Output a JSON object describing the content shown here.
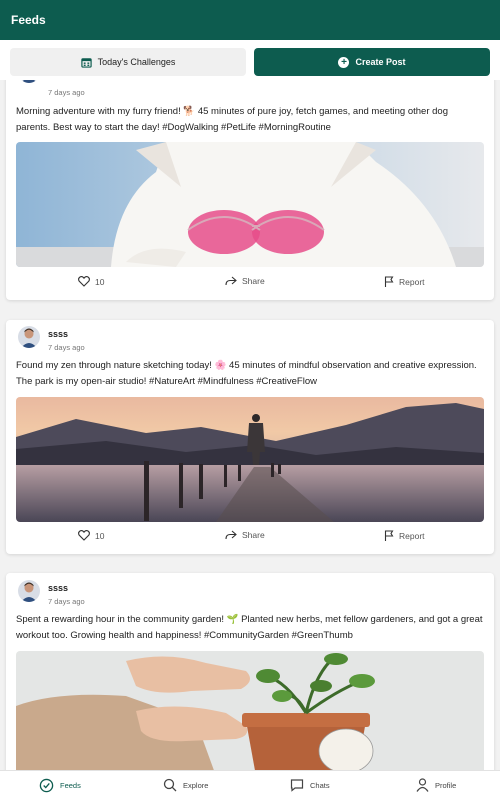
{
  "appbar": {
    "title": "Feeds"
  },
  "actions": {
    "challenges_label": "Today's Challenges",
    "create_label": "Create Post"
  },
  "posts": [
    {
      "username": "",
      "time": "7 days ago",
      "caption": "Morning adventure with my furry friend! 🐕 45 minutes of pure joy, fetch games, and meeting other dog parents. Best way to start the day! #DogWalking #PetLife #MorningRoutine",
      "image": "white-dog-pink-heart-sunglasses",
      "likes": "10",
      "share_label": "Share",
      "report_label": "Report"
    },
    {
      "username": "ssss",
      "time": "7 days ago",
      "caption": "Found my zen through nature sketching today! 🌸 45 minutes of mindful observation and creative expression. The park is my open-air studio! #NatureArt #Mindfulness #CreativeFlow",
      "image": "person-on-pier-sunset-lake",
      "likes": "10",
      "share_label": "Share",
      "report_label": "Report"
    },
    {
      "username": "ssss",
      "time": "7 days ago",
      "caption": "Spent a rewarding hour in the community garden! 🌱 Planted new herbs, met fellow gardeners, and got a great workout too. Growing health and happiness! #CommunityGarden #GreenThumb",
      "image": "hands-potting-plant",
      "likes": "",
      "share_label": "Share",
      "report_label": "Report"
    }
  ],
  "bottom_nav": [
    {
      "label": "Feeds",
      "icon": "feeds-icon",
      "active": true
    },
    {
      "label": "Explore",
      "icon": "search-icon",
      "active": false
    },
    {
      "label": "Chats",
      "icon": "chat-icon",
      "active": false
    },
    {
      "label": "Profile",
      "icon": "person-icon",
      "active": false
    }
  ],
  "colors": {
    "primary": "#0d5c4f",
    "background": "#f2f2f2",
    "card": "#ffffff"
  }
}
